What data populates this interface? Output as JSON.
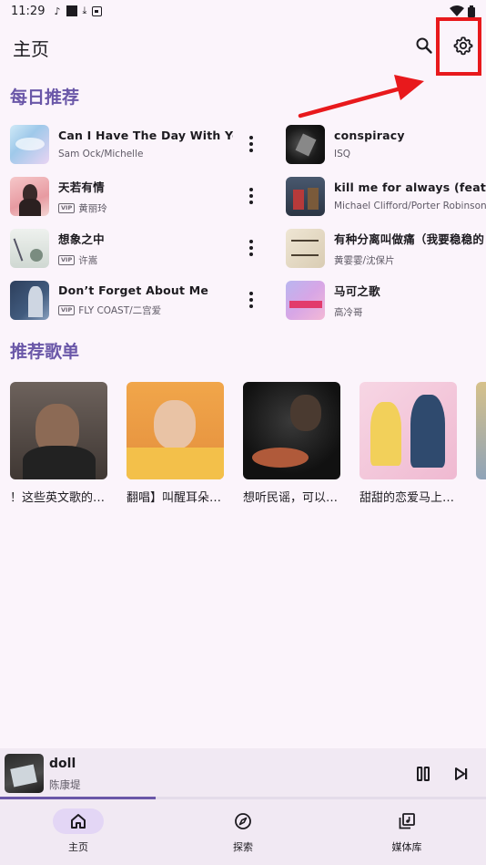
{
  "status_bar": {
    "time": "11:29"
  },
  "top_bar": {
    "title": "主页"
  },
  "sections": {
    "daily": "每日推荐",
    "playlists": "推荐歌单"
  },
  "daily_songs": [
    {
      "title": "Can I Have The Day With You",
      "artist": "Sam Ock/Michelle",
      "vip": false
    },
    {
      "title": "天若有情",
      "artist": "黄丽玲",
      "vip": true
    },
    {
      "title": "想象之中",
      "artist": "许嵩",
      "vip": true
    },
    {
      "title": "Don’t Forget About Me",
      "artist": "FLY COAST/二宫爱",
      "vip": true
    },
    {
      "title": "conspiracy",
      "artist": "ISQ",
      "vip": false
    },
    {
      "title": "kill me for always (feat. por",
      "artist": "Michael Clifford/Porter Robinson",
      "vip": false
    },
    {
      "title": "有种分离叫做痛（我要稳稳的",
      "artist": "黄霎霎/沈保片",
      "vip": false
    },
    {
      "title": "马可之歌",
      "artist": "高冷哥",
      "vip": false
    }
  ],
  "vip_label": "VIP",
  "playlists": [
    {
      "title": "！这些英文歌的…"
    },
    {
      "title": "翻唱】叫醒耳朵…"
    },
    {
      "title": "想听民谣，可以…"
    },
    {
      "title": "甜甜的恋爱马上…"
    }
  ],
  "now_playing": {
    "title": "doll",
    "artist": "陈康堤",
    "progress": 0.32
  },
  "bottom_nav": [
    {
      "label": "主页",
      "icon": "home-icon",
      "active": true
    },
    {
      "label": "探索",
      "icon": "compass-icon",
      "active": false
    },
    {
      "label": "媒体库",
      "icon": "library-icon",
      "active": false
    }
  ],
  "colors": {
    "accent": "#6a57a8",
    "annotation": "#e8191c",
    "background": "#fbf4fb"
  }
}
